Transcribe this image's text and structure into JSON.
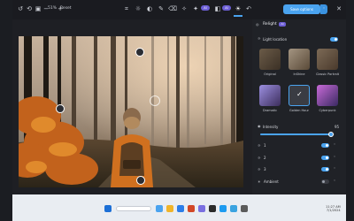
{
  "toolbar": {
    "zoom": "51%",
    "reset_label": "Reset",
    "badge_1": "AI",
    "badge_2": "AI",
    "save_label": "Save options",
    "save_caret": "˅",
    "icons": [
      "undo-icon",
      "redo-icon",
      "compare-icon",
      "crop-icon",
      "adjust-icon",
      "filter-icon",
      "markup-icon",
      "erase-icon",
      "background-icon",
      "relight-icon"
    ]
  },
  "panel": {
    "title": "Relight",
    "title_badge": "AI",
    "light_location_label": "Light location",
    "light_location_on": true,
    "presets": [
      {
        "label": "Original"
      },
      {
        "label": "InShine"
      },
      {
        "label": "Classic Portrait"
      },
      {
        "label": "Dramatic"
      },
      {
        "label": "Golden Hour"
      },
      {
        "label": "Cyberpunk"
      }
    ],
    "selected_preset": 4,
    "intensity_label": "Intensity",
    "intensity_value": "95",
    "intensity_fraction": 0.95,
    "lights": [
      {
        "label": "1",
        "on": true
      },
      {
        "label": "2",
        "on": true
      },
      {
        "label": "3",
        "on": true
      }
    ],
    "ambient_label": "Ambient",
    "ambient_on": false
  },
  "taskbar": {
    "time": "11:27 AM",
    "date": "7/1/2024",
    "colors": {
      "accent": "#4aa3ef",
      "purple": "#6d5fd6"
    }
  }
}
